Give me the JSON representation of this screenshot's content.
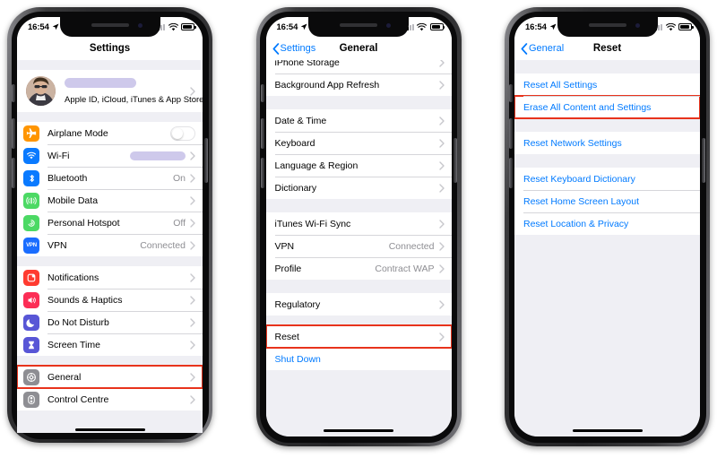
{
  "meta": {
    "background": "#ffffff",
    "accent_blue": "#007aff",
    "highlight_red": "#e8331c",
    "redaction_color": "#c5c0e8"
  },
  "status_bar": {
    "time": "16:54",
    "location_icon": "location-arrow-icon",
    "signal_icon": "cellular-bars-icon",
    "wifi_icon": "wifi-icon",
    "battery_icon": "battery-icon"
  },
  "phones": [
    {
      "id": "phone-settings",
      "nav": {
        "title": "Settings",
        "back": null
      },
      "profile": {
        "name_redacted": true,
        "subtitle": "Apple ID, iCloud, iTunes & App Store",
        "chevron": "chevron-right-icon",
        "avatar": "user-avatar"
      },
      "groups": [
        {
          "rows": [
            {
              "label": "Airplane Mode",
              "icon": "airplane-icon",
              "icon_color": "#ff9500",
              "control": "toggle",
              "toggle_on": false
            },
            {
              "label": "Wi-Fi",
              "icon": "wifi-icon",
              "icon_color": "#0a7aff",
              "value_redacted": true,
              "chevron": true
            },
            {
              "label": "Bluetooth",
              "icon": "bluetooth-icon",
              "icon_color": "#0a7aff",
              "value": "On",
              "chevron": true
            },
            {
              "label": "Mobile Data",
              "icon": "mobile-data-icon",
              "icon_color": "#4cd964",
              "value": "",
              "chevron": true
            },
            {
              "label": "Personal Hotspot",
              "icon": "hotspot-icon",
              "icon_color": "#4cd964",
              "value": "Off",
              "chevron": true
            },
            {
              "label": "VPN",
              "icon": "vpn-icon",
              "icon_color": "#1a6dff",
              "value": "Connected",
              "chevron": true
            }
          ]
        },
        {
          "rows": [
            {
              "label": "Notifications",
              "icon": "notifications-icon",
              "icon_color": "#ff3b30",
              "value": "",
              "chevron": true
            },
            {
              "label": "Sounds & Haptics",
              "icon": "sounds-icon",
              "icon_color": "#fc2d55",
              "value": "",
              "chevron": true
            },
            {
              "label": "Do Not Disturb",
              "icon": "moon-icon",
              "icon_color": "#5856d6",
              "value": "",
              "chevron": true
            },
            {
              "label": "Screen Time",
              "icon": "hourglass-icon",
              "icon_color": "#5856d6",
              "value": "",
              "chevron": true
            }
          ]
        },
        {
          "rows": [
            {
              "label": "General",
              "icon": "gear-icon",
              "icon_color": "#8e8e93",
              "value": "",
              "chevron": true,
              "highlighted": true
            },
            {
              "label": "Control Centre",
              "icon": "control-centre-icon",
              "icon_color": "#8e8e93",
              "value": "",
              "chevron": true
            }
          ]
        }
      ]
    },
    {
      "id": "phone-general",
      "nav": {
        "title": "General",
        "back": "Settings",
        "back_icon": "chevron-left-icon"
      },
      "groups": [
        {
          "clipped_top": true,
          "rows": [
            {
              "label": "iPhone Storage",
              "chevron": true
            },
            {
              "label": "Background App Refresh",
              "chevron": true
            }
          ]
        },
        {
          "rows": [
            {
              "label": "Date & Time",
              "chevron": true
            },
            {
              "label": "Keyboard",
              "chevron": true
            },
            {
              "label": "Language & Region",
              "chevron": true
            },
            {
              "label": "Dictionary",
              "chevron": true
            }
          ]
        },
        {
          "rows": [
            {
              "label": "iTunes Wi-Fi Sync",
              "chevron": true
            },
            {
              "label": "VPN",
              "value": "Connected",
              "chevron": true
            },
            {
              "label": "Profile",
              "value": "Contract WAP",
              "chevron": true
            }
          ]
        },
        {
          "rows": [
            {
              "label": "Regulatory",
              "chevron": true
            }
          ]
        },
        {
          "rows": [
            {
              "label": "Reset",
              "chevron": true,
              "highlighted": true
            },
            {
              "label": "Shut Down",
              "blue": true,
              "chevron": false
            }
          ]
        }
      ]
    },
    {
      "id": "phone-reset",
      "nav": {
        "title": "Reset",
        "back": "General",
        "back_icon": "chevron-left-icon"
      },
      "groups": [
        {
          "rows": [
            {
              "label": "Reset All Settings",
              "blue": true
            },
            {
              "label": "Erase All Content and Settings",
              "blue": true,
              "highlighted": true
            }
          ]
        },
        {
          "rows": [
            {
              "label": "Reset Network Settings",
              "blue": true
            }
          ]
        },
        {
          "rows": [
            {
              "label": "Reset Keyboard Dictionary",
              "blue": true
            },
            {
              "label": "Reset Home Screen Layout",
              "blue": true
            },
            {
              "label": "Reset Location & Privacy",
              "blue": true
            }
          ]
        }
      ]
    }
  ]
}
